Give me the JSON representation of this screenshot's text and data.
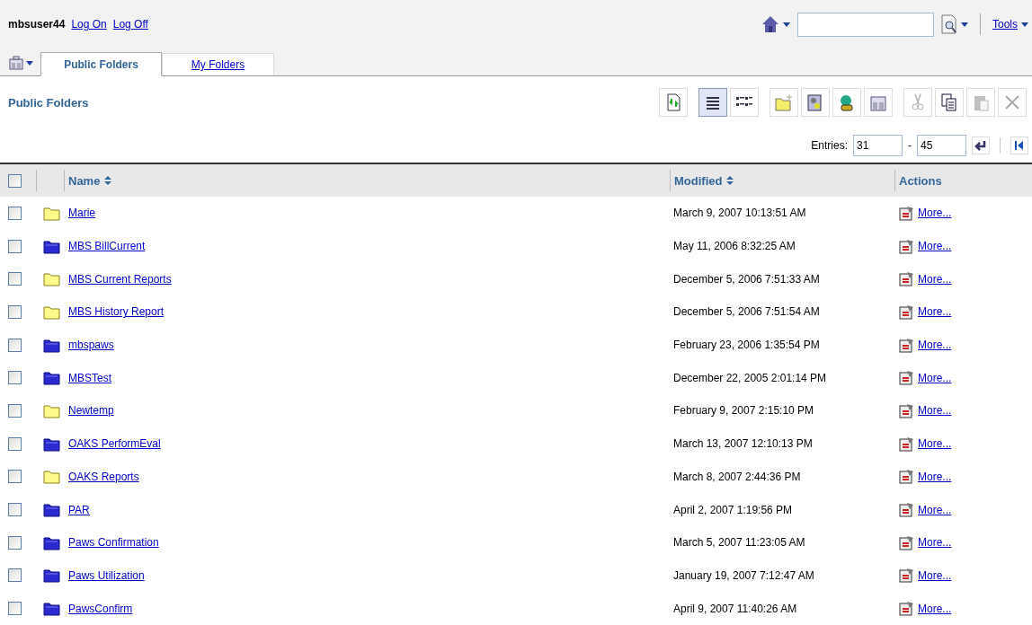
{
  "user": {
    "name": "mbsuser44",
    "links": [
      "Log On",
      "Log Off"
    ]
  },
  "tools_menu": "Tools",
  "tabs": [
    {
      "label": "Public Folders",
      "selected": true
    },
    {
      "label": "My Folders",
      "selected": false
    }
  ],
  "page_title": "Public Folders",
  "toolbar_groups": [
    [
      {
        "kind": "refresh",
        "selected": false,
        "disabled": false
      }
    ],
    [
      {
        "kind": "list",
        "selected": true,
        "disabled": false
      },
      {
        "kind": "details",
        "selected": false,
        "disabled": false
      }
    ],
    [
      {
        "kind": "new-folder",
        "selected": false,
        "disabled": false
      },
      {
        "kind": "new-job",
        "selected": false,
        "disabled": false
      },
      {
        "kind": "new-link",
        "selected": false,
        "disabled": false
      },
      {
        "kind": "new-page",
        "selected": false,
        "disabled": false
      }
    ],
    [
      {
        "kind": "cut",
        "selected": false,
        "disabled": true
      },
      {
        "kind": "copy",
        "selected": false,
        "disabled": false
      },
      {
        "kind": "paste",
        "selected": false,
        "disabled": true
      },
      {
        "kind": "delete",
        "selected": false,
        "disabled": true
      }
    ]
  ],
  "pagination": {
    "label": "Entries:",
    "from": "31",
    "separator": "-",
    "to": "45"
  },
  "table": {
    "header_checked": false,
    "columns": [
      "Name",
      "Modified",
      "Actions"
    ],
    "rows": [
      {
        "name": "Marie",
        "kind": "folder",
        "modified": "March 9, 2007 10:13:51 AM",
        "action": "More...",
        "checked": false
      },
      {
        "name": "MBS BillCurrent",
        "kind": "package",
        "modified": "May 11, 2006 8:32:25 AM",
        "action": "More...",
        "checked": false
      },
      {
        "name": "MBS Current Reports",
        "kind": "folder",
        "modified": "December 5, 2006 7:51:33 AM",
        "action": "More...",
        "checked": false
      },
      {
        "name": "MBS History Report",
        "kind": "folder",
        "modified": "December 5, 2006 7:51:54 AM",
        "action": "More...",
        "checked": false
      },
      {
        "name": "mbspaws",
        "kind": "package",
        "modified": "February 23, 2006 1:35:54 PM",
        "action": "More...",
        "checked": false
      },
      {
        "name": "MBSTest",
        "kind": "package",
        "modified": "December 22, 2005 2:01:14 PM",
        "action": "More...",
        "checked": false
      },
      {
        "name": "Newtemp",
        "kind": "folder",
        "modified": "February 9, 2007 2:15:10 PM",
        "action": "More...",
        "checked": false
      },
      {
        "name": "OAKS PerformEval",
        "kind": "package",
        "modified": "March 13, 2007 12:10:13 PM",
        "action": "More...",
        "checked": false
      },
      {
        "name": "OAKS Reports",
        "kind": "folder",
        "modified": "March 8, 2007 2:44:36 PM",
        "action": "More...",
        "checked": false
      },
      {
        "name": "PAR",
        "kind": "package",
        "modified": "April 2, 2007 1:19:56 PM",
        "action": "More...",
        "checked": false
      },
      {
        "name": "Paws Confirmation",
        "kind": "package",
        "modified": "March 5, 2007 11:23:05 AM",
        "action": "More...",
        "checked": false
      },
      {
        "name": "Paws Utilization",
        "kind": "package",
        "modified": "January 19, 2007 7:12:47 AM",
        "action": "More...",
        "checked": false
      },
      {
        "name": "PawsConfirm",
        "kind": "package",
        "modified": "April 9, 2007 11:40:26 AM",
        "action": "More...",
        "checked": false
      }
    ]
  }
}
